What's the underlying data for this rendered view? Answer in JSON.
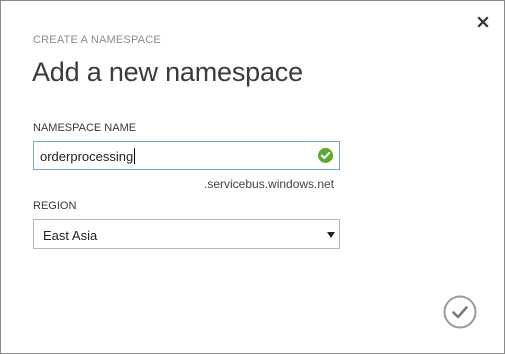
{
  "dialog": {
    "eyebrow": "CREATE A NAMESPACE",
    "title": "Add a new namespace",
    "close_icon": "close-icon",
    "confirm_icon": "checkmark-circle-icon"
  },
  "namespace_field": {
    "label": "NAMESPACE NAME",
    "value": "orderprocessing",
    "status_icon": "valid-check-icon",
    "status_color": "#5cab2e",
    "suffix": ".servicebus.windows.net"
  },
  "region_field": {
    "label": "REGION",
    "selected": "East Asia",
    "arrow_icon": "dropdown-arrow-icon"
  },
  "colors": {
    "focus_border": "#6fa9dc",
    "eyebrow_text": "#8c8c8c"
  }
}
